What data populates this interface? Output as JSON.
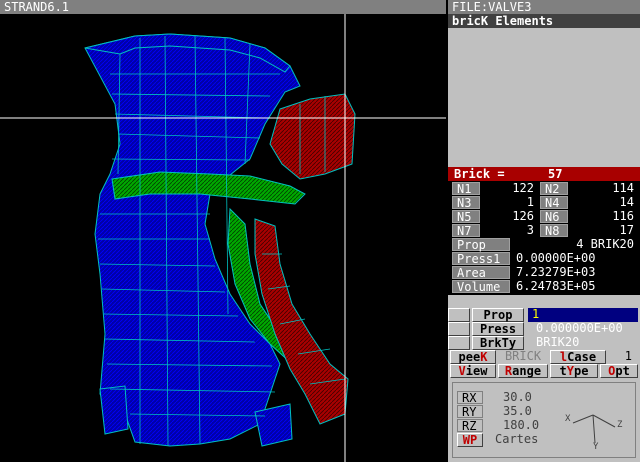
{
  "window": {
    "title": "STRAND6.1",
    "file": "FILE:VALVE3",
    "panel_title": "bricK Elements"
  },
  "brick": {
    "label": "Brick =",
    "number": "57"
  },
  "nodes": [
    {
      "label": "N1",
      "value": "122"
    },
    {
      "label": "N2",
      "value": "114"
    },
    {
      "label": "N3",
      "value": "1"
    },
    {
      "label": "N4",
      "value": "14"
    },
    {
      "label": "N5",
      "value": "126"
    },
    {
      "label": "N6",
      "value": "116"
    },
    {
      "label": "N7",
      "value": "3"
    },
    {
      "label": "N8",
      "value": "17"
    }
  ],
  "props": [
    {
      "label": "Prop",
      "value": "4 BRIK20"
    },
    {
      "label": "Press1",
      "value": "0.00000E+00"
    },
    {
      "label": "Area",
      "value": "7.23279E+03"
    },
    {
      "label": "Volume",
      "value": "6.24783E+05"
    }
  ],
  "edit": {
    "prop_label": "Prop",
    "prop_value": "1",
    "press_label": "Press",
    "press_value": "0.000000E+00",
    "brkty_label": "BrkTy",
    "brkty_value": "BRIK20"
  },
  "menu": {
    "peek_pre": "pee",
    "peek_key": "K",
    "brick": "BRICK",
    "lcase_key": "l",
    "lcase_rest": "Case",
    "lcase_value": "1",
    "view_key": "V",
    "view_rest": "iew",
    "range_key": "R",
    "range_rest": "ange",
    "type_pre": "t",
    "type_key": "Y",
    "type_rest": "pe",
    "opt_key": "O",
    "opt_rest": "pt"
  },
  "rotation": {
    "rx_label": "RX",
    "rx_value": "30.0",
    "ry_label": "RY",
    "ry_value": "35.0",
    "rz_label": "RZ",
    "rz_value": "180.0",
    "wp_key": "W",
    "wp_rest": "P",
    "wp_value": "Cartes",
    "axis_x": "X",
    "axis_y": "Y",
    "axis_z": "Z"
  },
  "colors": {
    "mesh_line": "#00c0c0",
    "blue_fill": "#0000a8",
    "green_fill": "#00a800",
    "red_fill": "#a80000",
    "selection_bar": "#a80000"
  }
}
